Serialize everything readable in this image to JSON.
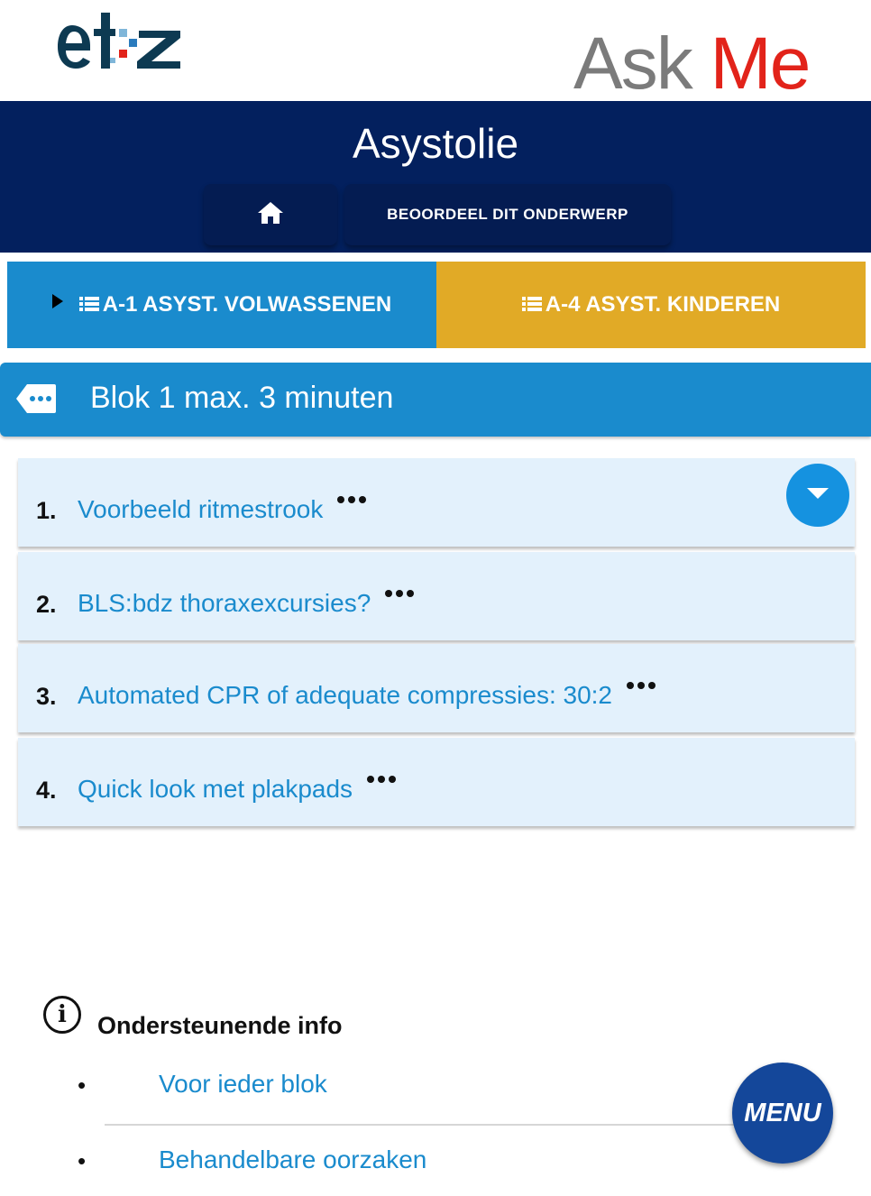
{
  "brand": {
    "etz_logo_text": "etz",
    "askme_logo": {
      "ask": "Ask",
      "me": "Me"
    }
  },
  "header": {
    "title": "Asystolie",
    "home_icon": "home-icon",
    "rate_label": "BEOORDEEL DIT ONDERWERP"
  },
  "tabs": [
    {
      "label": "A-1 ASYST. VOLWASSENEN",
      "icon": "list-icon",
      "color": "#1a8bcd"
    },
    {
      "label": "A-4 ASYST. KINDEREN",
      "icon": "list-icon",
      "color": "#e1aa26"
    }
  ],
  "block": {
    "title": "Blok 1 max. 3 minuten",
    "icon": "tag-dots-icon"
  },
  "items": [
    {
      "number": "1.",
      "label": "Voorbeeld ritmestrook"
    },
    {
      "number": "2.",
      "label": "BLS:bdz thoraxexcursies?"
    },
    {
      "number": "3.",
      "label": "Automated CPR of adequate compressies: 30:2"
    },
    {
      "number": "4.",
      "label": "Quick look met plakpads"
    }
  ],
  "info": {
    "title": "Ondersteunende info",
    "links": [
      "Voor ieder blok",
      "Behandelbare oorzaken"
    ]
  },
  "menu_label": "MENU",
  "colors": {
    "navy": "#03205e",
    "blue": "#1a8bcd",
    "gold": "#e1aa26",
    "red": "#e2231a"
  }
}
